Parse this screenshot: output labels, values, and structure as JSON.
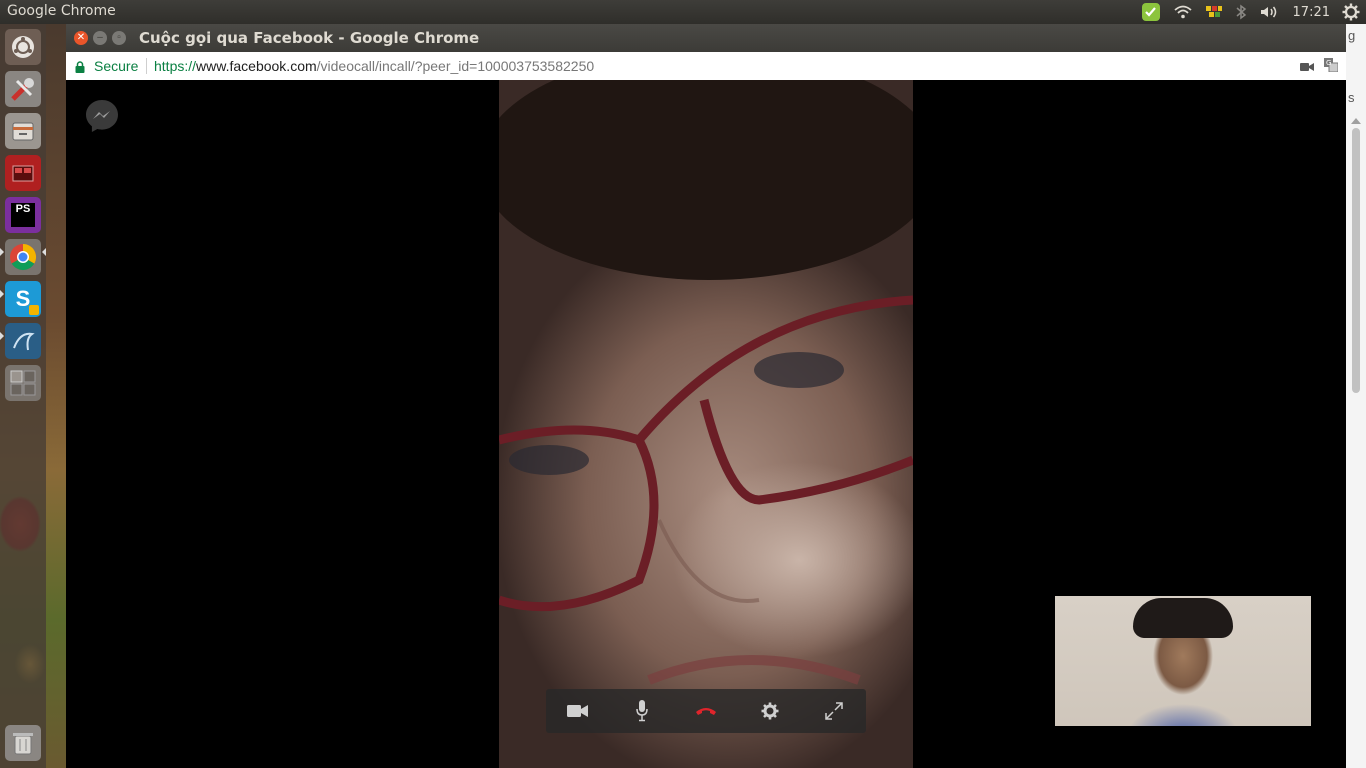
{
  "top_panel": {
    "app_title": "Google Chrome",
    "clock": "17:21",
    "tray_icons": [
      "update-icon",
      "wifi-icon",
      "network-indicator-icon",
      "bluetooth-icon",
      "volume-icon",
      "settings-gear-icon"
    ]
  },
  "launcher": {
    "items": [
      {
        "name": "ubuntu-home"
      },
      {
        "name": "system-settings"
      },
      {
        "name": "files"
      },
      {
        "name": "workspace-app"
      },
      {
        "name": "phpstorm",
        "label": "PS"
      },
      {
        "name": "google-chrome"
      },
      {
        "name": "skype",
        "label": "S"
      },
      {
        "name": "mysql-workbench"
      },
      {
        "name": "workspace-switcher"
      },
      {
        "name": "trash"
      }
    ]
  },
  "window": {
    "title": "Cuộc gọi qua Facebook - Google Chrome",
    "buttons": [
      "close",
      "minimize",
      "maximize"
    ]
  },
  "omnibox": {
    "security_label": "Secure",
    "url_scheme": "https://",
    "url_host": "www.facebook.com",
    "url_path": "/videocall/incall/?peer_id=100003753582250"
  },
  "background_page": {
    "right_edge_text_1": "g",
    "right_edge_text_2": "s"
  },
  "call": {
    "controls": [
      "video-camera",
      "microphone",
      "end-call",
      "settings",
      "fullscreen"
    ],
    "colors": {
      "end_call": "#e0242b",
      "control_icon": "#d0d0d0"
    }
  }
}
